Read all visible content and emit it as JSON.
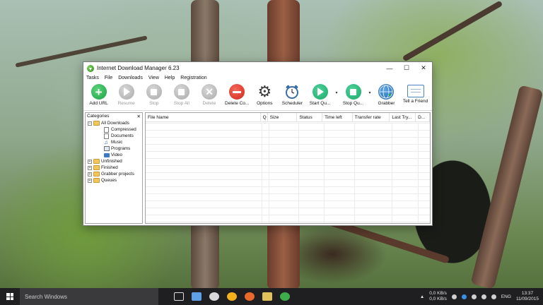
{
  "window": {
    "title": "Internet Download Manager 6.23",
    "controls": {
      "minimize": "—",
      "maximize": "☐",
      "close": "✕"
    }
  },
  "menu": [
    "Tasks",
    "File",
    "Downloads",
    "View",
    "Help",
    "Registration"
  ],
  "toolbar": {
    "add_url": "Add URL",
    "resume": "Resume",
    "stop": "Stop",
    "stop_all": "Stop All",
    "delete": "Delete",
    "delete_completed": "Delete Co...",
    "options": "Options",
    "scheduler": "Scheduler",
    "start_queue": "Start Qu...",
    "stop_queue": "Stop Qu...",
    "grabber": "Grabber",
    "tell_friend": "Tell a Friend",
    "dropdown": "▾"
  },
  "categories": {
    "title": "Categories",
    "close": "✕",
    "items": {
      "all_downloads": "All Downloads",
      "compressed": "Compressed",
      "documents": "Documents",
      "music": "Music",
      "programs": "Programs",
      "video": "Video",
      "unfinished": "Unfinished",
      "finished": "Finished",
      "grabber_projects": "Grabber projects",
      "queues": "Queues"
    },
    "expand_minus": "−",
    "expand_plus": "+"
  },
  "columns": [
    "File Name",
    "Q",
    "Size",
    "Status",
    "Time left",
    "Transfer rate",
    "Last Try...",
    "D..."
  ],
  "taskbar": {
    "search_placeholder": "Search Windows",
    "net_up": "0,0 KB/s",
    "net_down": "0,0 KB/s",
    "language": "ENG",
    "time": "13:37",
    "date": "11/09/2015"
  },
  "colors": {
    "accent_green": "#18a046",
    "delete_red": "#d32416",
    "taskbar": "#1f1f22"
  }
}
